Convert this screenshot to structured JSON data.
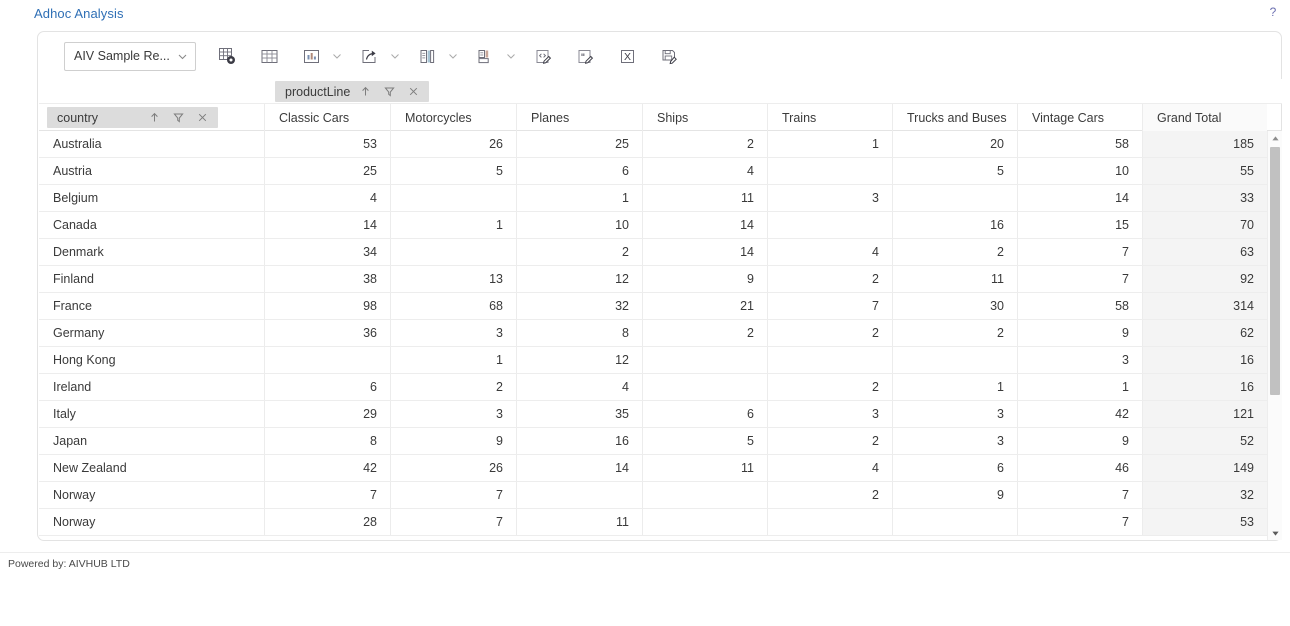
{
  "app": {
    "title": "Adhoc Analysis",
    "help_icon": "question-mark-icon"
  },
  "footer": {
    "text": "Powered by: AIVHUB LTD"
  },
  "toolbar": {
    "report_select": {
      "value": "AIV Sample Re...",
      "icon": "chevron-down-icon"
    },
    "buttons": [
      {
        "name": "configure-grid-button",
        "icon": "grid-settings-icon",
        "caret": false
      },
      {
        "name": "table-view-button",
        "icon": "table-icon",
        "caret": false
      },
      {
        "name": "chart-view-button",
        "icon": "bar-chart-icon",
        "caret": true
      },
      {
        "name": "export-share-button",
        "icon": "share-export-icon",
        "caret": true
      },
      {
        "name": "layout-side-button",
        "icon": "layout-side-icon",
        "caret": true
      },
      {
        "name": "layout-top-button",
        "icon": "layout-top-icon",
        "caret": true
      },
      {
        "name": "edit-code-button",
        "icon": "code-edit-icon",
        "caret": false
      },
      {
        "name": "edit-text-button",
        "icon": "text-edit-icon",
        "caret": false
      },
      {
        "name": "export-excel-button",
        "icon": "excel-x-icon",
        "caret": false
      },
      {
        "name": "save-report-button",
        "icon": "save-disk-icon",
        "caret": false
      }
    ]
  },
  "grid": {
    "column_field": {
      "label": "productLine",
      "sort_icon": "sort-asc-arrow-icon",
      "filter_icon": "funnel-icon",
      "remove_icon": "close-x-icon"
    },
    "row_field": {
      "label": "country",
      "sort_icon": "sort-asc-arrow-icon",
      "filter_icon": "funnel-icon",
      "remove_icon": "close-x-icon"
    },
    "columns": [
      "Classic Cars",
      "Motorcycles",
      "Planes",
      "Ships",
      "Trains",
      "Trucks and Buses",
      "Vintage Cars",
      "Grand Total"
    ],
    "rows": [
      {
        "country": "Australia",
        "values": [
          "53",
          "26",
          "25",
          "2",
          "1",
          "20",
          "58",
          "185"
        ]
      },
      {
        "country": "Austria",
        "values": [
          "25",
          "5",
          "6",
          "4",
          "",
          "5",
          "10",
          "55"
        ]
      },
      {
        "country": "Belgium",
        "values": [
          "4",
          "",
          "1",
          "11",
          "3",
          "",
          "14",
          "33"
        ]
      },
      {
        "country": "Canada",
        "values": [
          "14",
          "1",
          "10",
          "14",
          "",
          "16",
          "15",
          "70"
        ]
      },
      {
        "country": "Denmark",
        "values": [
          "34",
          "",
          "2",
          "14",
          "4",
          "2",
          "7",
          "63"
        ]
      },
      {
        "country": "Finland",
        "values": [
          "38",
          "13",
          "12",
          "9",
          "2",
          "11",
          "7",
          "92"
        ]
      },
      {
        "country": "France",
        "values": [
          "98",
          "68",
          "32",
          "21",
          "7",
          "30",
          "58",
          "314"
        ]
      },
      {
        "country": "Germany",
        "values": [
          "36",
          "3",
          "8",
          "2",
          "2",
          "2",
          "9",
          "62"
        ]
      },
      {
        "country": "Hong Kong",
        "values": [
          "",
          "1",
          "12",
          "",
          "",
          "",
          "3",
          "16"
        ]
      },
      {
        "country": "Ireland",
        "values": [
          "6",
          "2",
          "4",
          "",
          "2",
          "1",
          "1",
          "16"
        ]
      },
      {
        "country": "Italy",
        "values": [
          "29",
          "3",
          "35",
          "6",
          "3",
          "3",
          "42",
          "121"
        ]
      },
      {
        "country": "Japan",
        "values": [
          "8",
          "9",
          "16",
          "5",
          "2",
          "3",
          "9",
          "52"
        ]
      },
      {
        "country": "New Zealand",
        "values": [
          "42",
          "26",
          "14",
          "11",
          "4",
          "6",
          "46",
          "149"
        ]
      },
      {
        "country": "Norway",
        "values": [
          "7",
          "7",
          "",
          "",
          "2",
          "9",
          "7",
          "32"
        ]
      },
      {
        "country": "Norway",
        "values": [
          "28",
          "7",
          "11",
          "",
          "",
          "",
          "7",
          "53"
        ]
      }
    ],
    "scrollbar": {
      "up_icon": "scroll-up-arrow-icon",
      "down_icon": "scroll-down-arrow-icon"
    }
  },
  "colors": {
    "accent": "#2f6fb5",
    "pill": "#dcdcdc",
    "total_column": "#f4f4f4",
    "help": "#6b6fb0"
  }
}
